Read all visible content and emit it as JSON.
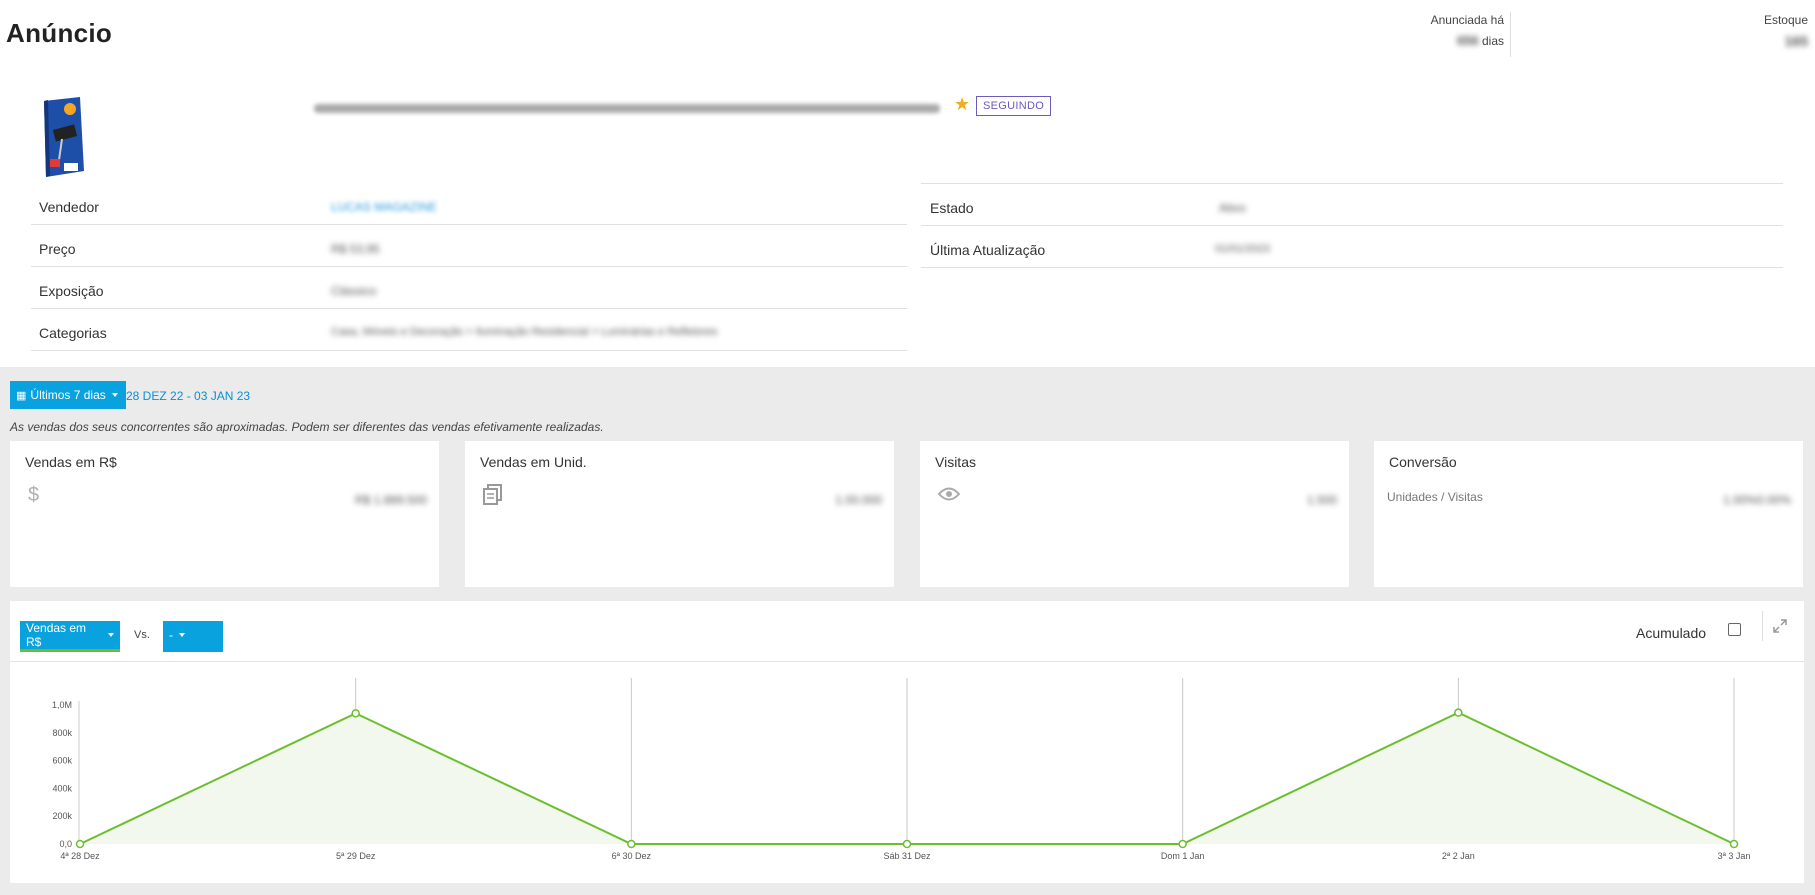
{
  "header": {
    "title": "Anúncio",
    "announced_label": "Anunciada há",
    "announced_value": "656",
    "announced_unit": "dias",
    "stock_label": "Estoque",
    "stock_value": "165"
  },
  "product": {
    "following_badge": "SEGUINDO"
  },
  "details_left": [
    {
      "label": "Vendedor",
      "value": "LUCAS MAGAZINE"
    },
    {
      "label": "Preço",
      "value": "R$ 53,95"
    },
    {
      "label": "Exposição",
      "value": "Clássico"
    },
    {
      "label": "Categorias",
      "value": "Casa, Móveis e Decoração > Iluminação Residencial > Luminárias e Refletores"
    }
  ],
  "details_right": [
    {
      "label": "Estado",
      "value": "Ativo"
    },
    {
      "label": "Última Atualização",
      "value": "01/01/2023"
    }
  ],
  "filters": {
    "period_button": "Últimos 7 dias",
    "date_range": "28 DEZ 22 - 03 JAN 23",
    "disclaimer": "As vendas dos seus concorrentes são aproximadas. Podem ser diferentes das vendas efetivamente realizadas."
  },
  "cards": [
    {
      "title": "Vendas em R$",
      "icon": "dollar-icon",
      "value": "R$ 1.889.500"
    },
    {
      "title": "Vendas em Unid.",
      "icon": "copies-icon",
      "value": "1.00.000"
    },
    {
      "title": "Visitas",
      "icon": "eye-icon",
      "value": "1.500"
    },
    {
      "title": "Conversão",
      "subtitle": "Unidades / Visitas",
      "value": "1.00%0.00%"
    }
  ],
  "chart_controls": {
    "metric_select": "Vendas em R$",
    "vs_label": "Vs.",
    "compare_select": "-",
    "accumulated_label": "Acumulado"
  },
  "chart_data": {
    "type": "area",
    "x": [
      "4ª 28 Dez",
      "5ª 29 Dez",
      "6ª 30 Dez",
      "Sáb 31 Dez",
      "Dom 1 Jan",
      "2ª 2 Jan",
      "3ª 3 Jan"
    ],
    "series": [
      {
        "values": [
          0,
          940000,
          0,
          0,
          0,
          945000,
          0
        ]
      }
    ],
    "y_ticks": [
      "0,0",
      "200k",
      "400k",
      "600k",
      "800k",
      "1,0M"
    ],
    "ylim": [
      0,
      1000000
    ],
    "grid": "vertical",
    "colors": {
      "line": "#6bbf2e",
      "fill": "#f3f8ee"
    }
  }
}
